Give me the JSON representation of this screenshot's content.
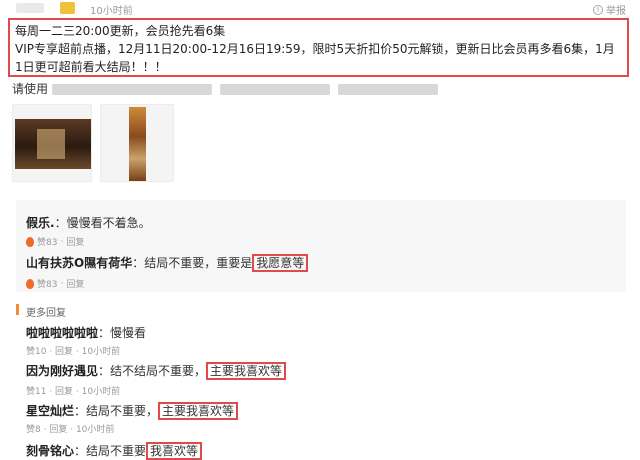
{
  "header": {
    "time": "10小时前",
    "report_label": "举报"
  },
  "notice": {
    "line1": "每周一二三20:00更新，会员抢先看6集",
    "line2": "VIP专享超前点播，12月11日20:00-12月16日19:59，限时5天折扣价50元解锁，更新日比会员再多看6集，1月1日更可超前看大结局！！！"
  },
  "ask": {
    "prefix": "请使用"
  },
  "comments": [
    {
      "name": "假乐.",
      "sep": "：",
      "text": "慢慢看不着急。",
      "likes": "赞83",
      "reply": "回复"
    },
    {
      "name": "山有扶苏O隰有荷华",
      "sep": "：",
      "text": "结局不重要，重要是",
      "highlight": "我愿意等",
      "likes": "赞83",
      "reply": "回复"
    }
  ],
  "more": {
    "title": "更多回复",
    "items": [
      {
        "name": "啦啦啦啦啦啦",
        "sep": "：",
        "text": "慢慢看",
        "likes": "赞10",
        "reply": "回复",
        "time": "10小时前"
      },
      {
        "name": "因为刚好遇见",
        "sep": "：",
        "text": "结不结局不重要，",
        "highlight": "主要我喜欢等",
        "likes": "赞11",
        "reply": "回复",
        "time": "10小时前"
      },
      {
        "name": "星空灿烂",
        "sep": "：",
        "text": "结局不重要，",
        "highlight": "主要我喜欢等",
        "likes": "赞8",
        "reply": "回复",
        "time": "10小时前"
      },
      {
        "name": "刻骨铭心",
        "sep": "：",
        "text": "结局不重要",
        "highlight": "我喜欢等"
      }
    ]
  },
  "colors": {
    "highlight_border": "#e04a4a",
    "accent": "#f28a3a",
    "like": "#f06a2a"
  }
}
